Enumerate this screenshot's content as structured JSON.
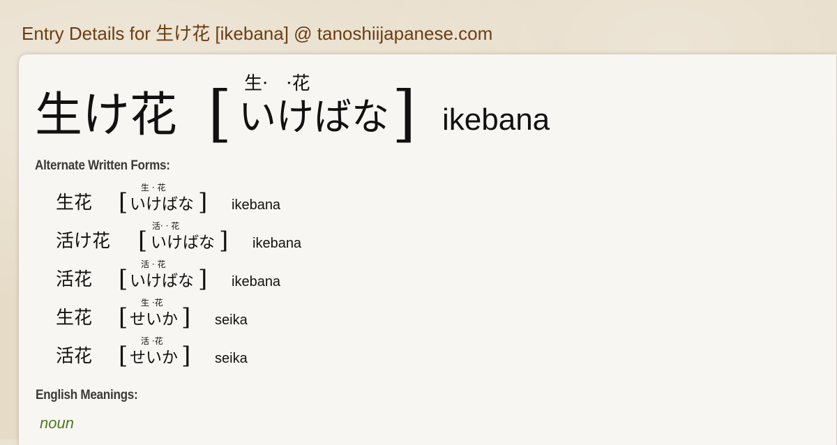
{
  "page": {
    "title": "Entry Details for 生け花 [ikebana] @ tanoshiijapanese.com"
  },
  "entry": {
    "kanji": "生け花",
    "bracket_open": "[",
    "bracket_close": "]",
    "furigana": "生·　·花",
    "kana": "いけばな",
    "romaji": "ikebana"
  },
  "alternate_forms": {
    "label": "Alternate Written Forms:",
    "items": [
      {
        "kanji": "生花",
        "furigana": "生 · 花",
        "kana": "いけばな",
        "romaji": "ikebana"
      },
      {
        "kanji": "活け花",
        "furigana": "活· · 花",
        "kana": "いけばな",
        "romaji": "ikebana"
      },
      {
        "kanji": "活花",
        "furigana": "活 · 花",
        "kana": "いけばな",
        "romaji": "ikebana"
      },
      {
        "kanji": "生花",
        "furigana": "生 ·花",
        "kana": "せいか",
        "romaji": "seika"
      },
      {
        "kanji": "活花",
        "furigana": "活 ·花",
        "kana": "せいか",
        "romaji": "seika"
      }
    ]
  },
  "meanings": {
    "label": "English Meanings:",
    "part_of_speech": "noun"
  },
  "colors": {
    "title": "#6b3e12",
    "part_of_speech": "#4d7a1c",
    "card": "#f7f6f2",
    "background": "#e6dbc7"
  }
}
